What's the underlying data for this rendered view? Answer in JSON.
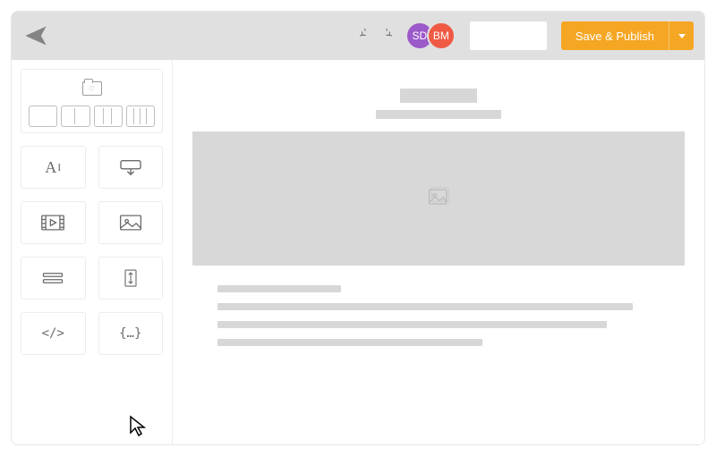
{
  "header": {
    "save_label": "Save & Publish",
    "avatars": [
      {
        "initials": "SD",
        "color": "purple"
      },
      {
        "initials": "BM",
        "color": "red"
      }
    ]
  },
  "sidebar": {
    "column_layouts": [
      1,
      2,
      3,
      4
    ],
    "blocks": [
      {
        "name": "text-block"
      },
      {
        "name": "button-block"
      },
      {
        "name": "video-block"
      },
      {
        "name": "image-block"
      },
      {
        "name": "divider-block"
      },
      {
        "name": "spacer-block"
      },
      {
        "name": "code-block"
      },
      {
        "name": "snippet-block"
      }
    ]
  },
  "canvas": {
    "placeholder_lines": [
      "short",
      "full",
      "w88",
      "w60"
    ]
  }
}
